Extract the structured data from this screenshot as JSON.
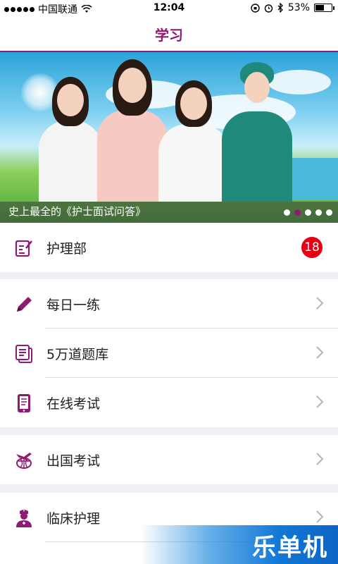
{
  "status_bar": {
    "carrier": "中国联通",
    "time": "12:04",
    "battery": "53%",
    "battery_level": 0.53
  },
  "nav": {
    "title": "学习"
  },
  "banner": {
    "caption": "史上最全的《护士面试问答》",
    "pages": 5,
    "active_page": 2
  },
  "list": {
    "nursing_dept": {
      "label": "护理部",
      "badge": "18",
      "icon": "edit-note-icon"
    },
    "daily_practice": {
      "label": "每日一练",
      "icon": "pencil-icon"
    },
    "question_bank": {
      "label": "5万道题库",
      "icon": "documents-icon"
    },
    "online_exam": {
      "label": "在线考试",
      "icon": "tablet-icon"
    },
    "overseas_exam": {
      "label": "出国考试",
      "icon": "airplane-globe-icon"
    },
    "clinical_nursing": {
      "label": "临床护理",
      "icon": "nurse-icon"
    },
    "partial_row": {
      "label": ""
    }
  },
  "colors": {
    "accent": "#8e1a73",
    "badge": "#e60012"
  },
  "watermark": "乐单机"
}
